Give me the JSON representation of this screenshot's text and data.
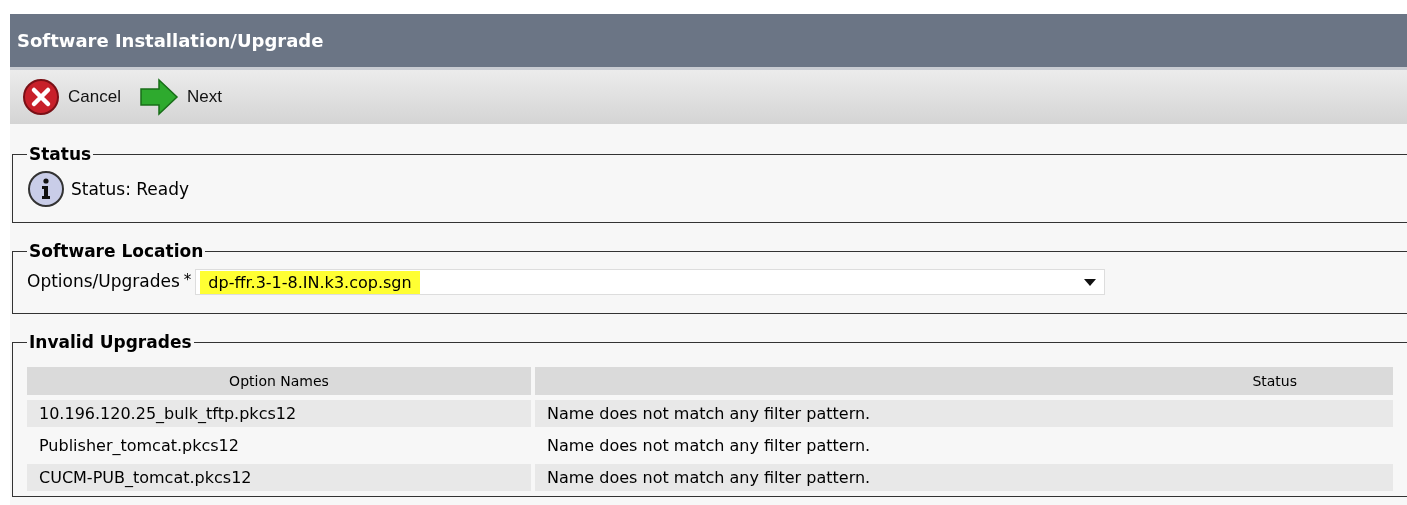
{
  "window": {
    "title": "Software Installation/Upgrade"
  },
  "toolbar": [
    {
      "kind": "cancel",
      "label": "Cancel"
    },
    {
      "kind": "next",
      "label": "Next"
    }
  ],
  "status_section": {
    "legend": "Status",
    "message": "Status: Ready"
  },
  "location_section": {
    "legend": "Software Location",
    "field_label": "Options/Upgrades",
    "required_mark": "*",
    "value": "dp-ffr.3-1-8.IN.k3.cop.sgn",
    "highlighted": true
  },
  "invalid_section": {
    "legend": "Invalid Upgrades",
    "columns": [
      "Option Names",
      "Status"
    ],
    "rows": [
      [
        "10.196.120.25_bulk_tftp.pkcs12",
        "Name does not match any filter pattern."
      ],
      [
        "Publisher_tomcat.pkcs12",
        "Name does not match any filter pattern."
      ],
      [
        "CUCM-PUB_tomcat.pkcs12",
        "Name does not match any filter pattern."
      ]
    ]
  }
}
